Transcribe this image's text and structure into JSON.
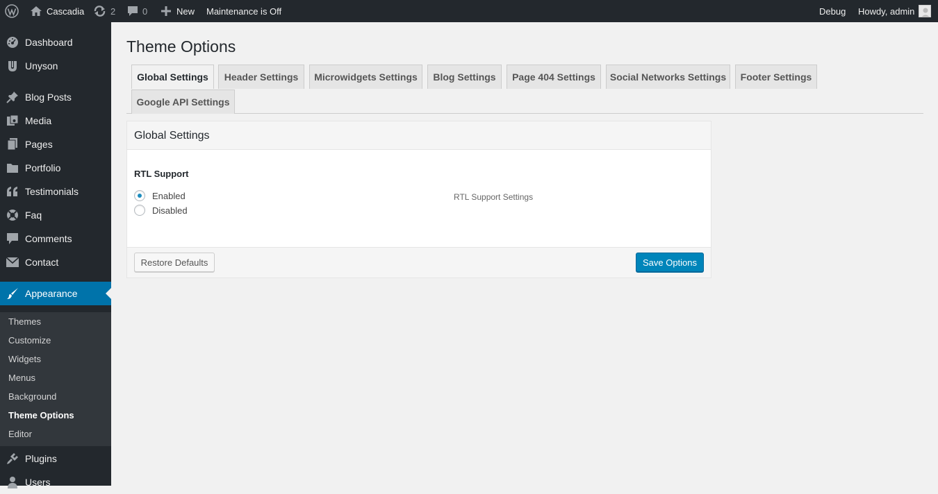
{
  "adminbar": {
    "site_name": "Cascadia",
    "updates_count": "2",
    "comments_count": "0",
    "new_label": "New",
    "maintenance_label": "Maintenance is Off",
    "debug_label": "Debug",
    "howdy_label": "Howdy, admin"
  },
  "sidebar": {
    "items": [
      {
        "label": "Dashboard",
        "icon": "dashboard-icon"
      },
      {
        "label": "Unyson",
        "icon": "unyson-icon"
      },
      {
        "label": "Blog Posts",
        "icon": "pushpin-icon"
      },
      {
        "label": "Media",
        "icon": "media-icon"
      },
      {
        "label": "Pages",
        "icon": "pages-icon"
      },
      {
        "label": "Portfolio",
        "icon": "folder-icon"
      },
      {
        "label": "Testimonials",
        "icon": "quote-icon"
      },
      {
        "label": "Faq",
        "icon": "lifebuoy-icon"
      },
      {
        "label": "Comments",
        "icon": "comment-icon"
      },
      {
        "label": "Contact",
        "icon": "envelope-icon"
      },
      {
        "label": "Appearance",
        "icon": "paintbrush-icon"
      },
      {
        "label": "Plugins",
        "icon": "plugin-icon"
      },
      {
        "label": "Users",
        "icon": "users-icon"
      }
    ],
    "submenu": [
      "Themes",
      "Customize",
      "Widgets",
      "Menus",
      "Background",
      "Theme Options",
      "Editor"
    ]
  },
  "page": {
    "title": "Theme Options",
    "tabs": [
      "Global Settings",
      "Header Settings",
      "Microwidgets Settings",
      "Blog Settings",
      "Page 404 Settings",
      "Social Networks Settings",
      "Footer Settings",
      "Google API Settings"
    ]
  },
  "panel": {
    "title": "Global Settings",
    "field_label": "RTL Support",
    "options": [
      "Enabled",
      "Disabled"
    ],
    "selected": "Enabled",
    "description": "RTL Support Settings",
    "restore_label": "Restore Defaults",
    "save_label": "Save Options"
  },
  "colors": {
    "accent": "#0073aa",
    "adminbar_bg": "#23282d",
    "submenu_bg": "#32373c",
    "primary_button": "#0085ba"
  }
}
